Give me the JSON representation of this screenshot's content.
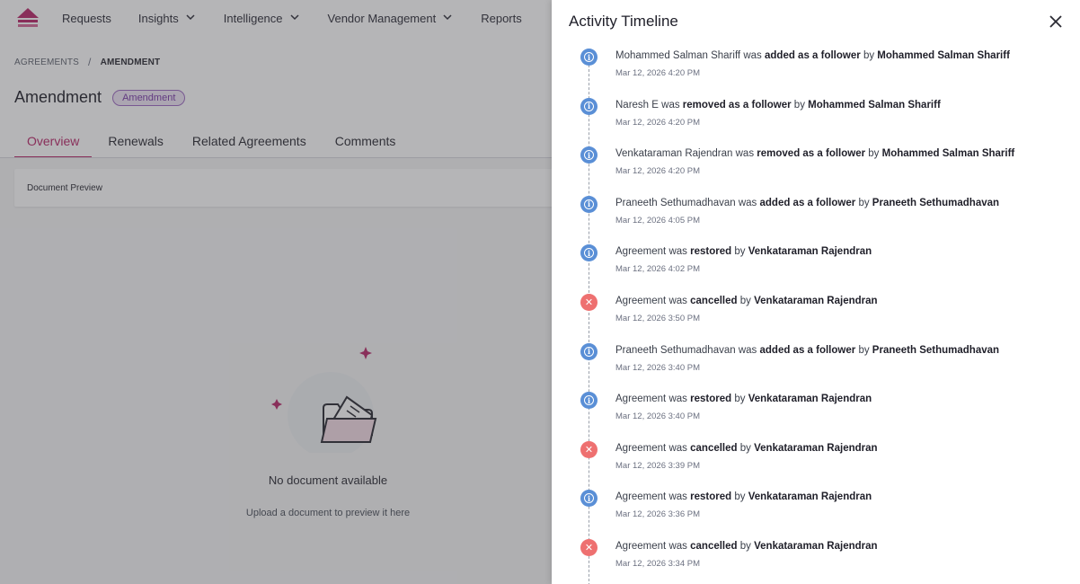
{
  "nav": {
    "items": [
      {
        "label": "Requests",
        "has_dropdown": false
      },
      {
        "label": "Insights",
        "has_dropdown": true
      },
      {
        "label": "Intelligence",
        "has_dropdown": true
      },
      {
        "label": "Vendor Management",
        "has_dropdown": true
      },
      {
        "label": "Reports",
        "has_dropdown": false
      }
    ]
  },
  "breadcrumb": {
    "parent": "AGREEMENTS",
    "separator": "/",
    "current": "AMENDMENT"
  },
  "page": {
    "title": "Amendment",
    "badge": "Amendment"
  },
  "tabs": [
    {
      "label": "Overview",
      "active": true
    },
    {
      "label": "Renewals",
      "active": false
    },
    {
      "label": "Related Agreements",
      "active": false
    },
    {
      "label": "Comments",
      "active": false
    }
  ],
  "preview": {
    "header": "Document Preview",
    "empty_title": "No document available",
    "empty_subtitle": "Upload a document to preview it here"
  },
  "drawer": {
    "title": "Activity Timeline",
    "close_icon": "close-icon"
  },
  "timeline": [
    {
      "type": "info",
      "subject": "Mohammed Salman Shariff",
      "verb": "was",
      "action": "added as a follower",
      "by": "by",
      "actor": "Mohammed Salman Shariff",
      "time": "Mar 12, 2026 4:20 PM"
    },
    {
      "type": "info",
      "subject": "Naresh E",
      "verb": "was",
      "action": "removed as a follower",
      "by": "by",
      "actor": "Mohammed Salman Shariff",
      "time": "Mar 12, 2026 4:20 PM"
    },
    {
      "type": "info",
      "subject": "Venkataraman Rajendran",
      "verb": "was",
      "action": "removed as a follower",
      "by": "by",
      "actor": "Mohammed Salman Shariff",
      "time": "Mar 12, 2026 4:20 PM"
    },
    {
      "type": "info",
      "subject": "Praneeth Sethumadhavan",
      "verb": "was",
      "action": "added as a follower",
      "by": "by",
      "actor": "Praneeth Sethumadhavan",
      "time": "Mar 12, 2026 4:05 PM"
    },
    {
      "type": "info",
      "subject": "Agreement",
      "verb": "was",
      "action": "restored",
      "by": "by",
      "actor": "Venkataraman Rajendran",
      "time": "Mar 12, 2026 4:02 PM"
    },
    {
      "type": "cancel",
      "subject": "Agreement",
      "verb": "was",
      "action": "cancelled",
      "by": "by",
      "actor": "Venkataraman Rajendran",
      "time": "Mar 12, 2026 3:50 PM"
    },
    {
      "type": "info",
      "subject": "Praneeth Sethumadhavan",
      "verb": "was",
      "action": "added as a follower",
      "by": "by",
      "actor": "Praneeth Sethumadhavan",
      "time": "Mar 12, 2026 3:40 PM"
    },
    {
      "type": "info",
      "subject": "Agreement",
      "verb": "was",
      "action": "restored",
      "by": "by",
      "actor": "Venkataraman Rajendran",
      "time": "Mar 12, 2026 3:40 PM"
    },
    {
      "type": "cancel",
      "subject": "Agreement",
      "verb": "was",
      "action": "cancelled",
      "by": "by",
      "actor": "Venkataraman Rajendran",
      "time": "Mar 12, 2026 3:39 PM"
    },
    {
      "type": "info",
      "subject": "Agreement",
      "verb": "was",
      "action": "restored",
      "by": "by",
      "actor": "Venkataraman Rajendran",
      "time": "Mar 12, 2026 3:36 PM"
    },
    {
      "type": "cancel",
      "subject": "Agreement",
      "verb": "was",
      "action": "cancelled",
      "by": "by",
      "actor": "Venkataraman Rajendran",
      "time": "Mar 12, 2026 3:34 PM"
    }
  ],
  "colors": {
    "accent": "#b8286a",
    "info_icon": "#5a8fd6",
    "cancel_icon": "#ee7070",
    "badge_text": "#7a3aa8"
  }
}
